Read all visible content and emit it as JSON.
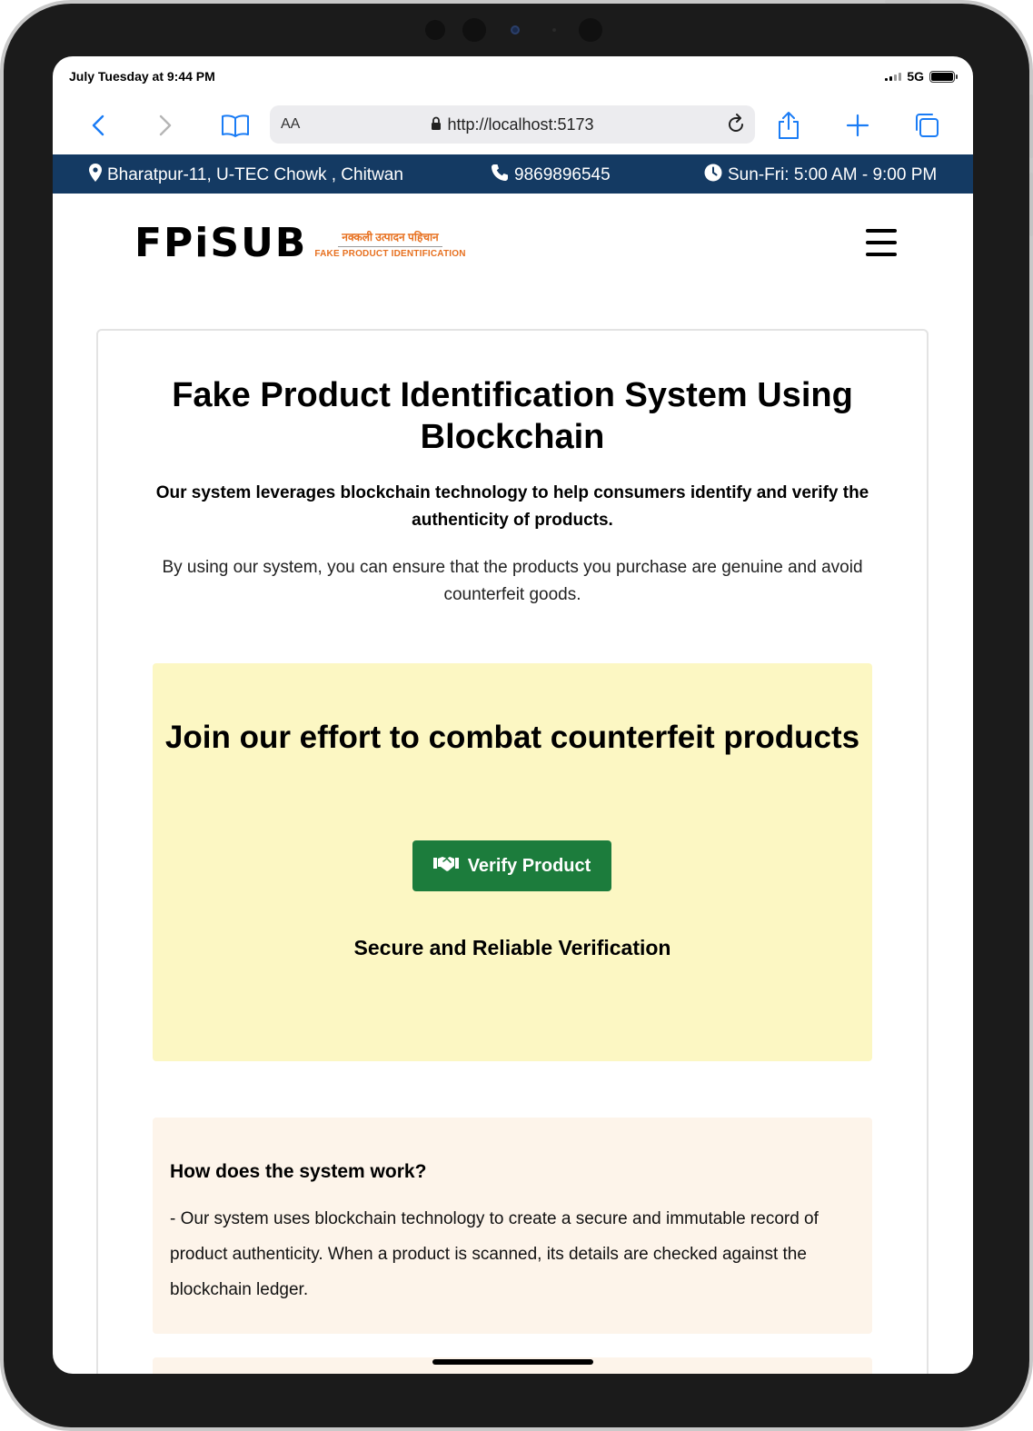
{
  "status_bar": {
    "time": "July Tuesday at 9:44 PM",
    "network": "5G"
  },
  "browser": {
    "text_size_label": "AA",
    "url": "http://localhost:5173",
    "icons": [
      "back-icon",
      "forward-icon",
      "bookmarks-icon",
      "lock-icon",
      "reload-icon",
      "share-icon",
      "new-tab-icon",
      "tabs-icon"
    ]
  },
  "info_bar": {
    "address": "Bharatpur-11, U-TEC Chowk , Chitwan",
    "phone": "9869896545",
    "hours": "Sun-Fri: 5:00 AM - 9:00 PM",
    "background": "#143a63"
  },
  "logo": {
    "text": "FPiSUB",
    "tagline_hindi": "नक्कली उत्पादन पहिचान",
    "tagline_english": "FAKE PRODUCT IDENTIFICATION",
    "accent": "#e7701f"
  },
  "hero": {
    "title": "Fake Product Identification System Using Blockchain",
    "subtitle": "Our system leverages blockchain technology to help consumers identify and verify the authenticity of products.",
    "description": "By using our system, you can ensure that the products you purchase are genuine and avoid counterfeit goods."
  },
  "cta": {
    "heading": "Join our effort to combat counterfeit products",
    "button_label": "Verify Product",
    "button_color": "#1c7c3c",
    "tagline": "Secure and Reliable Verification",
    "background": "#fcf7c3"
  },
  "faq": {
    "question": "How does the system work?",
    "answer": "- Our system uses blockchain technology to create a secure and immutable record of product authenticity. When a product is scanned, its details are checked against the blockchain ledger.",
    "background": "#fdf4ea"
  }
}
